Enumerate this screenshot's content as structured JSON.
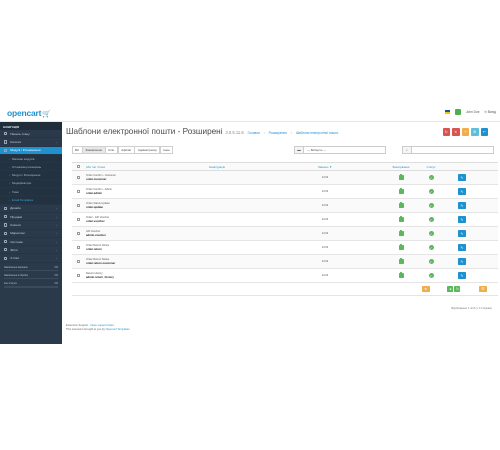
{
  "header": {
    "logo": "opencart",
    "user_name": "John Doe",
    "logout": "Вихід"
  },
  "sidebar": {
    "title": "НАВІГАЦІЯ",
    "items": [
      {
        "label": "Панель стану",
        "active": false
      },
      {
        "label": "Каталог",
        "active": false
      },
      {
        "label": "Модулі / Розширення",
        "active": true
      },
      {
        "label": "Магазин модулів",
        "sub": true
      },
      {
        "label": "Установка розширень",
        "sub": true
      },
      {
        "label": "Модулі / Розширення",
        "sub": true
      },
      {
        "label": "Модифікатори",
        "sub": true
      },
      {
        "label": "Теми",
        "sub": true
      },
      {
        "label": "Email Templates",
        "sub": true,
        "current": true
      },
      {
        "label": "Дизайн"
      },
      {
        "label": "Продажі"
      },
      {
        "label": "Клієнти"
      },
      {
        "label": "Маркетинг"
      },
      {
        "label": "Система"
      },
      {
        "label": "Звіти"
      },
      {
        "label": "X-Cart"
      }
    ],
    "progress": [
      {
        "label": "Замовлення виконано",
        "value": "0%",
        "fraction": 0
      },
      {
        "label": "Замовлення в обробці",
        "value": "0%",
        "fraction": 0
      },
      {
        "label": "Інші статуси",
        "value": "0%",
        "fraction": 0
      }
    ]
  },
  "page": {
    "title": "Шаблони електронної пошти - Розширені",
    "version": "3.0.5.11.6",
    "breadcrumbs": [
      "Головна",
      "Розширення",
      "Шаблони електронної пошти"
    ],
    "actions": [
      {
        "icon": "refresh-icon",
        "glyph": "↻",
        "color": "#d9534f"
      },
      {
        "icon": "trash-icon",
        "glyph": "✕",
        "color": "#d9534f"
      },
      {
        "icon": "plus-icon",
        "glyph": "+",
        "color": "#f0ad4e"
      },
      {
        "icon": "gear-icon",
        "glyph": "⚙",
        "color": "#5bc0de"
      },
      {
        "icon": "back-icon",
        "glyph": "↩",
        "color": "#1e91cf"
      }
    ]
  },
  "filters": {
    "tabs": [
      "Всі",
      "Замовлення",
      "Кліє.",
      "Афіліат",
      "Адміністратор",
      "Інше"
    ],
    "active_tab": "Замовлення",
    "select_placeholder": "--- Виберіть ---",
    "search_placeholder": ""
  },
  "table": {
    "headers": {
      "name": "Або тип / Ключ",
      "files": "Конф/ураціи",
      "updated": "Змінено ▼",
      "backup": "Бекапування",
      "status": "Статус"
    },
    "rows": [
      {
        "title": "Order Confirm - Customer",
        "key": "order.customer",
        "updated": "12:04"
      },
      {
        "title": "Order Confirm - Admin",
        "key": "order.admin",
        "updated": "12:04"
      },
      {
        "title": "Order Status Update",
        "key": "order.update",
        "updated": "12:04"
      },
      {
        "title": "Order - Gift Voucher",
        "key": "order.voucher",
        "updated": "12:04"
      },
      {
        "title": "Gift Voucher",
        "key": "admin.voucher",
        "updated": "12:04"
      },
      {
        "title": "Order Return Notice",
        "key": "order.return",
        "updated": "12:04"
      },
      {
        "title": "Order Return Status",
        "key": "order.return.customer",
        "updated": "12:04"
      },
      {
        "title": "Return History",
        "key": "admin.return_history",
        "updated": "12:04"
      }
    ],
    "pagination": "Відображено 1 по 8 (з 1 Сторінки)"
  },
  "footer": {
    "line1_prefix": "Extension Support - ",
    "line1_link": "Open support ticket",
    "line2_prefix": "This extension brought to you by ",
    "line2_link": "Opencart Templates"
  }
}
